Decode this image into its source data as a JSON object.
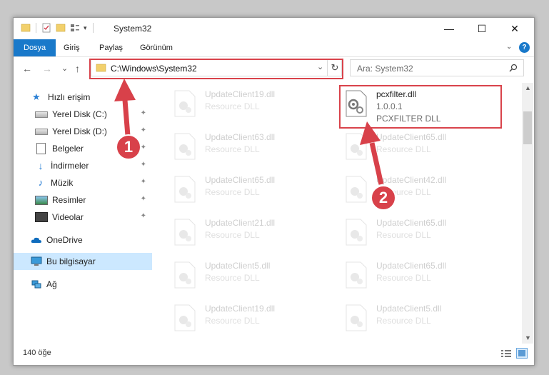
{
  "window": {
    "title": "System32",
    "minimize_glyph": "—",
    "maximize_glyph": "☐",
    "close_glyph": "✕"
  },
  "ribbon": {
    "tabs": [
      "Dosya",
      "Giriş",
      "Paylaş",
      "Görünüm"
    ],
    "active_tab": "Dosya",
    "accent": "#1979ca"
  },
  "nav": {
    "back_glyph": "←",
    "forward_glyph": "→",
    "recent_glyph": "⌄",
    "up_glyph": "↑",
    "address": "C:\\Windows\\System32",
    "search_placeholder": "Ara: System32"
  },
  "sidebar": {
    "items": [
      {
        "label": "Hızlı erişim",
        "icon": "star-icon"
      },
      {
        "label": "Yerel Disk (C:)",
        "icon": "drive-icon",
        "pinned": true
      },
      {
        "label": "Yerel Disk (D:)",
        "icon": "drive-icon",
        "pinned": true
      },
      {
        "label": "Belgeler",
        "icon": "documents-icon",
        "pinned": true
      },
      {
        "label": "İndirmeler",
        "icon": "downloads-icon",
        "pinned": true
      },
      {
        "label": "Müzik",
        "icon": "music-icon",
        "pinned": true
      },
      {
        "label": "Resimler",
        "icon": "pictures-icon",
        "pinned": true
      },
      {
        "label": "Videolar",
        "icon": "videos-icon",
        "pinned": true
      },
      {
        "label": "OneDrive",
        "icon": "onedrive-icon"
      },
      {
        "label": "Bu bilgisayar",
        "icon": "this-pc-icon",
        "selected": true
      },
      {
        "label": "Ağ",
        "icon": "network-icon"
      }
    ],
    "pin_glyph": "📌"
  },
  "files": {
    "left": [
      {
        "name": "UpdateClient19.dll",
        "type": "Resource DLL"
      },
      {
        "name": "UpdateClient63.dll",
        "type": "Resource DLL"
      },
      {
        "name": "UpdateClient65.dll",
        "type": "Resource DLL"
      },
      {
        "name": "UpdateClient21.dll",
        "type": "Resource DLL"
      },
      {
        "name": "UpdateClient5.dll",
        "type": "Resource DLL"
      },
      {
        "name": "UpdateClient19.dll",
        "type": "Resource DLL"
      }
    ],
    "right": [
      {
        "name": "UpdateClient65.dll",
        "type": "Resource DLL"
      },
      {
        "name": "UpdateClient42.dll",
        "type": "Resource DLL"
      },
      {
        "name": "UpdateClient65.dll",
        "type": "Resource DLL"
      },
      {
        "name": "UpdateClient65.dll",
        "type": "Resource DLL"
      },
      {
        "name": "UpdateClient5.dll",
        "type": "Resource DLL"
      }
    ],
    "highlighted": {
      "name": "pcxfilter.dll",
      "version": "1.0.0.1",
      "description": "PCXFILTER DLL"
    }
  },
  "status": {
    "item_count": "140 öğe"
  },
  "callouts": [
    "1",
    "2"
  ],
  "colors": {
    "highlight": "#d9434b",
    "callout": "#d8414a",
    "selection": "#cce8ff"
  }
}
